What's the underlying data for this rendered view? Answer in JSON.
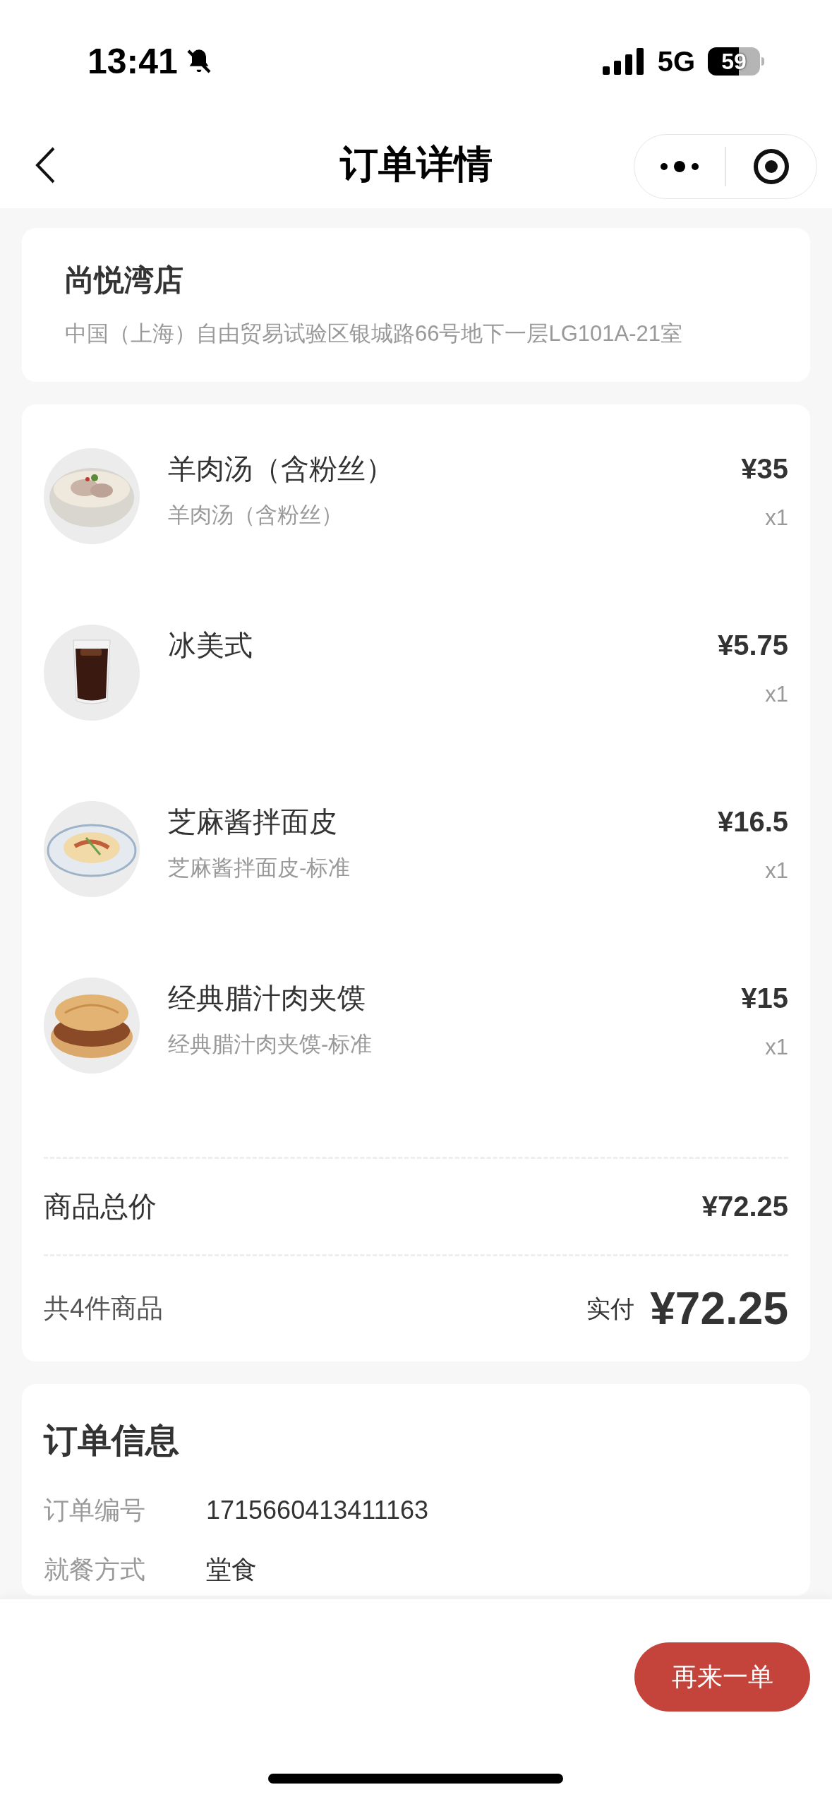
{
  "status_bar": {
    "time": "13:41",
    "network": "5G",
    "battery": "59"
  },
  "nav": {
    "title": "订单详情"
  },
  "store": {
    "name": "尚悦湾店",
    "address": "中国（上海）自由贸易试验区银城路66号地下一层LG101A-21室"
  },
  "items": [
    {
      "name": "羊肉汤（含粉丝）",
      "spec": "羊肉汤（含粉丝）",
      "price": "¥35",
      "qty": "x1",
      "kind": "soup"
    },
    {
      "name": "冰美式",
      "price": "¥5.75",
      "qty": "x1",
      "kind": "drink"
    },
    {
      "name": "芝麻酱拌面皮",
      "spec": "芝麻酱拌面皮-标准",
      "price": "¥16.5",
      "qty": "x1",
      "kind": "noodles"
    },
    {
      "name": "经典腊汁肉夹馍",
      "spec": "经典腊汁肉夹馍-标准",
      "price": "¥15",
      "qty": "x1",
      "kind": "bun"
    }
  ],
  "totals": {
    "subtotal_label": "商品总价",
    "subtotal": "¥72.25",
    "count_label": "共4件商品",
    "paid_label": "实付",
    "paid": "¥72.25"
  },
  "order_info": {
    "title": "订单信息",
    "rows": [
      {
        "label": "订单编号",
        "value": "1715660413411163"
      },
      {
        "label": "就餐方式",
        "value": "堂食"
      }
    ]
  },
  "footer": {
    "button": "再来一单"
  }
}
